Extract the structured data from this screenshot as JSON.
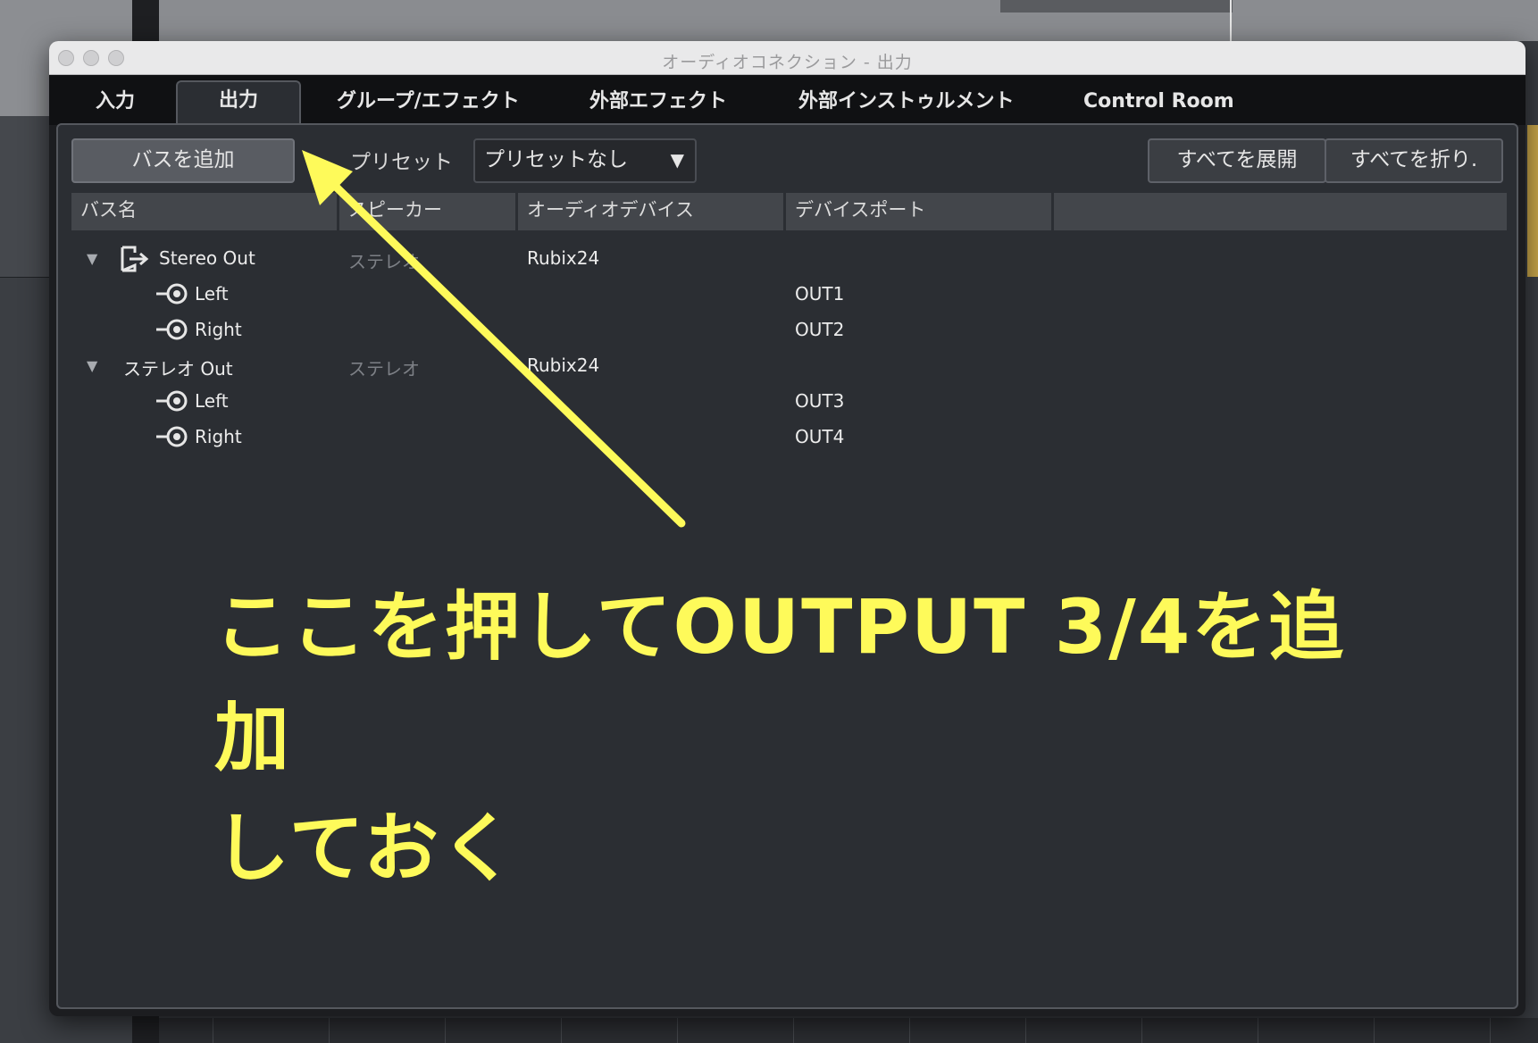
{
  "window": {
    "title": "オーディオコネクション - 出力"
  },
  "tabs": [
    {
      "label": "入力",
      "active": false
    },
    {
      "label": "出力",
      "active": true
    },
    {
      "label": "グループ/エフェクト",
      "active": false
    },
    {
      "label": "外部エフェクト",
      "active": false
    },
    {
      "label": "外部インストゥルメント",
      "active": false
    },
    {
      "label": "Control Room",
      "active": false
    }
  ],
  "toolbar": {
    "add_bus_label": "バスを追加",
    "preset_label": "プリセット",
    "preset_value": "プリセットなし",
    "preset_arrow": "▼",
    "expand_all_label": "すべてを展開",
    "collapse_all_label": "すべてを折り."
  },
  "columns": [
    "バス名",
    "スピーカー",
    "オーディオデバイス",
    "デバイスポート",
    ""
  ],
  "buses": [
    {
      "name": "Stereo Out",
      "speaker": "ステレオ",
      "device": "Rubix24",
      "has_icon": true,
      "channels": [
        {
          "name": "Left",
          "port": "OUT1"
        },
        {
          "name": "Right",
          "port": "OUT2"
        }
      ]
    },
    {
      "name": "ステレオ Out",
      "speaker": "ステレオ",
      "device": "Rubix24",
      "has_icon": false,
      "channels": [
        {
          "name": "Left",
          "port": "OUT3"
        },
        {
          "name": "Right",
          "port": "OUT4"
        }
      ]
    }
  ],
  "annotation": {
    "line1": "ここを押してOUTPUT 3/4を追加",
    "line2": "しておく",
    "color": "#fefa5a"
  },
  "icons": {
    "expand": "▼",
    "output_bus": "output-bus-icon",
    "channel": "channel-output-icon"
  }
}
